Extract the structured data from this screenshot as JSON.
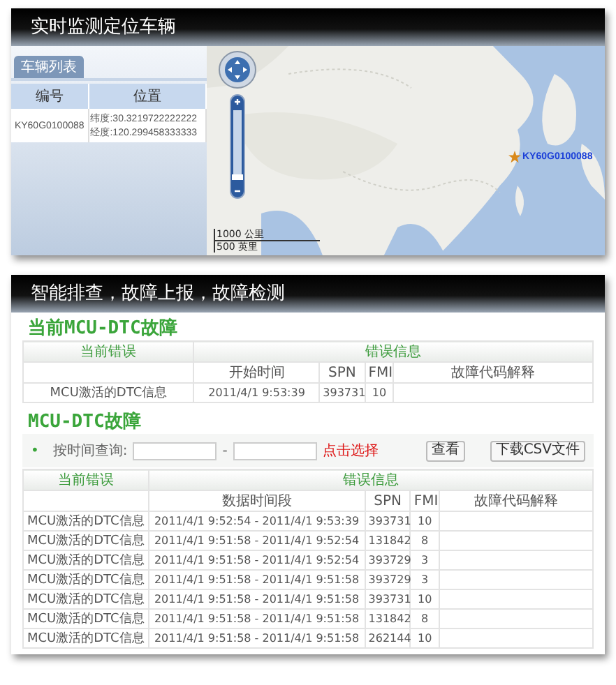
{
  "top_panel": {
    "title": "实时监测定位车辆",
    "tab": "车辆列表",
    "vehicle_table": {
      "columns": [
        "编号",
        "位置"
      ],
      "rows": [
        {
          "id": "KY60G0100088",
          "latitude": "纬度:30.3219722222222",
          "longitude": "经度:120.299458333333"
        }
      ]
    },
    "map": {
      "kind": "picture",
      "vehicle_label": "KY60G0100088",
      "scale": [
        "1000 公里",
        "500 英里"
      ]
    }
  },
  "bottom_panel": {
    "title": "智能排查，故障上报，故障检测",
    "current_faults": {
      "heading": "当前MCU-DTC故障",
      "group_columns": [
        "当前错误",
        "错误信息"
      ],
      "columns": [
        "开始时间",
        "SPN",
        "FMI",
        "故障代码解释"
      ],
      "rows": [
        {
          "error": "MCU激活的DTC信息",
          "time": "2011/4/1 9:53:39",
          "spn": "393731",
          "fmi": "10"
        }
      ]
    },
    "fault_history": {
      "heading": "MCU-DTC故障",
      "filter": {
        "bullet": "•",
        "label": "按时间查询:",
        "separator": "-",
        "pick_link": "点击选择",
        "buttons": [
          "查看",
          "下载CSV文件"
        ]
      },
      "group_columns": [
        "当前错误",
        "错误信息"
      ],
      "columns": [
        "数据时间段",
        "SPN",
        "FMI",
        "故障代码解释"
      ],
      "rows": [
        {
          "error": "MCU激活的DTC信息",
          "time": "2011/4/1 9:52:54 - 2011/4/1 9:53:39",
          "spn": "393731",
          "fmi": "10"
        },
        {
          "error": "MCU激活的DTC信息",
          "time": "2011/4/1 9:51:58 - 2011/4/1 9:52:54",
          "spn": "131842",
          "fmi": "8"
        },
        {
          "error": "MCU激活的DTC信息",
          "time": "2011/4/1 9:51:58 - 2011/4/1 9:52:54",
          "spn": "393729",
          "fmi": "3"
        },
        {
          "error": "MCU激活的DTC信息",
          "time": "2011/4/1 9:51:58 - 2011/4/1 9:51:58",
          "spn": "393729",
          "fmi": "3"
        },
        {
          "error": "MCU激活的DTC信息",
          "time": "2011/4/1 9:51:58 - 2011/4/1 9:51:58",
          "spn": "393731",
          "fmi": "10"
        },
        {
          "error": "MCU激活的DTC信息",
          "time": "2011/4/1 9:51:58 - 2011/4/1 9:51:58",
          "spn": "131842",
          "fmi": "8"
        },
        {
          "error": "MCU激活的DTC信息",
          "time": "2011/4/1 9:51:58 - 2011/4/1 9:51:58",
          "spn": "262144",
          "fmi": "10"
        }
      ]
    }
  }
}
